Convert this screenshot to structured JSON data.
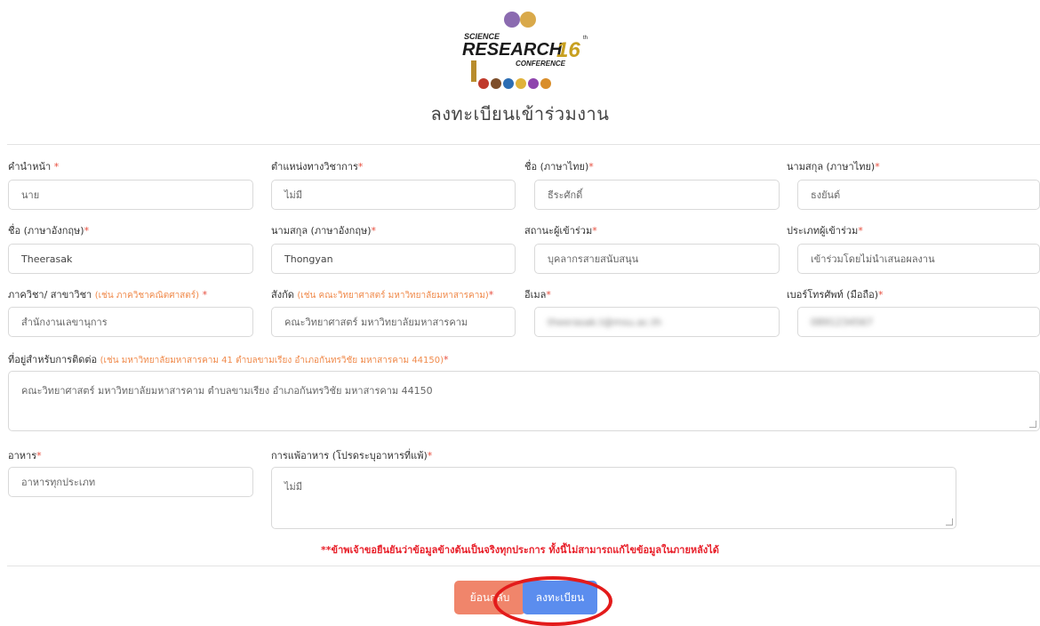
{
  "logo": {
    "line1": "SCIENCE",
    "line2": "RESEARCH",
    "edition": "16",
    "sup": "th",
    "line3": "CONFERENCE"
  },
  "page_title": "ลงทะเบียนเข้าร่วมงาน",
  "required_mark": "*",
  "fields": {
    "prefix": {
      "label": "คำนำหน้า",
      "value": "นาย"
    },
    "academic_position": {
      "label": "ตำแหน่งทางวิชาการ",
      "value": "ไม่มี"
    },
    "first_name_th": {
      "label": "ชื่อ (ภาษาไทย)",
      "value": "ธีระศักดิ์"
    },
    "last_name_th": {
      "label": "นามสกุล (ภาษาไทย)",
      "value": "ธงยันต์"
    },
    "first_name_en": {
      "label": "ชื่อ (ภาษาอังกฤษ)",
      "value": "Theerasak"
    },
    "last_name_en": {
      "label": "นามสกุล (ภาษาอังกฤษ)",
      "value": "Thongyan"
    },
    "participant_status": {
      "label": "สถานะผู้เข้าร่วม",
      "value": "บุคลากรสายสนับสนุน"
    },
    "participant_type": {
      "label": "ประเภทผู้เข้าร่วม",
      "value": "เข้าร่วมโดยไม่นำเสนอผลงาน"
    },
    "department": {
      "label": "ภาควิชา/ สาขาวิชา",
      "hint": "(เช่น ภาควิชาคณิตศาสตร์)",
      "value": "สำนักงานเลขานุการ"
    },
    "affiliation": {
      "label": "สังกัด",
      "hint": "(เช่น คณะวิทยาศาสตร์ มหาวิทยาลัยมหาสารคาม)",
      "value": "คณะวิทยาศาสตร์ มหาวิทยาลัยมหาสารคาม"
    },
    "email": {
      "label": "อีเมล",
      "value": "theerasak.t@msu.ac.th"
    },
    "phone": {
      "label": "เบอร์โทรศัพท์ (มือถือ)",
      "value": "0891234567"
    },
    "address": {
      "label": "ที่อยู่สำหรับการติดต่อ",
      "hint": "(เช่น มหาวิทยาลัยมหาสารคาม 41 ตำบลขามเรียง อำเภอกันทรวิชัย มหาสารคาม 44150)",
      "value": "คณะวิทยาศาสตร์ มหาวิทยาลัยมหาสารคาม ตำบลขามเรียง อำเภอกันทรวิชัย มหาสารคาม 44150"
    },
    "food": {
      "label": "อาหาร",
      "value": "อาหารทุกประเภท"
    },
    "allergy": {
      "label": "การแพ้อาหาร (โปรดระบุอาหารที่แพ้)",
      "value": "ไม่มี"
    }
  },
  "confirm_text": "**ข้าพเจ้าขอยืนยันว่าข้อมูลข้างต้นเป็นจริงทุกประการ ทั้งนี้ไม่สามารถแก้ไขข้อมูลในภายหลังได้",
  "buttons": {
    "back": "ย้อนกลับ",
    "register": "ลงทะเบียน"
  },
  "colors": {
    "required": "#e74c3c",
    "hint": "#f08a4b",
    "back_button": "#f0856b",
    "register_button": "#5b8dee",
    "highlight_circle": "#e31b1b"
  }
}
